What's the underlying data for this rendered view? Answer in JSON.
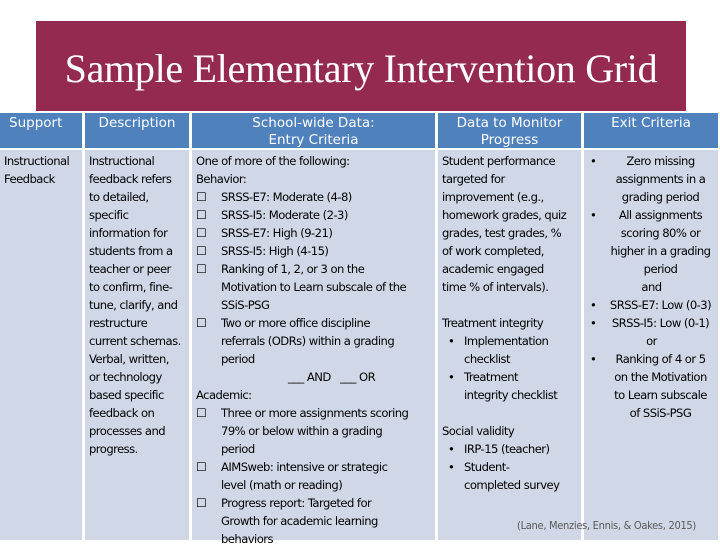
{
  "title": "Sample Elementary Intervention Grid",
  "colors": {
    "banner": "#952a51",
    "header": "#4f81bd",
    "cell": "#d0d8e8"
  },
  "headers": {
    "support": "Support",
    "description": "Description",
    "entry": [
      "School-wide Data:",
      "Entry Criteria"
    ],
    "monitor": [
      "Data to Monitor",
      "Progress"
    ],
    "exit": "Exit Criteria"
  },
  "row": {
    "support": [
      "Instructional",
      "Feedback"
    ],
    "description": [
      "Instructional",
      "feedback refers",
      "to detailed,",
      "specific",
      "information for",
      "students from a",
      "teacher or peer",
      "to confirm, fine-",
      "tune, clarify, and",
      "restructure",
      "current schemas.",
      "Verbal, written,",
      "or technology",
      "based specific",
      "feedback on",
      "processes and",
      "progress."
    ],
    "entry": {
      "intro": "One of more of the following:",
      "behavior_label": "Behavior:",
      "behavior_items": [
        [
          "SRSS-E7: Moderate (4-8)"
        ],
        [
          "SRSS-I5: Moderate (2-3)"
        ],
        [
          "SRSS-E7: High (9-21)"
        ],
        [
          "SRSS-I5: High (4-15)"
        ],
        [
          "Ranking of 1, 2, or 3 on the",
          "Motivation to Learn subscale of the",
          "SSiS-PSG"
        ],
        [
          "Two or more office discipline",
          "referrals (ODRs) within a grading",
          "period"
        ]
      ],
      "connector": "___ AND   ___ OR",
      "academic_label": "Academic:",
      "academic_items": [
        [
          "Three or more assignments scoring",
          "79% or below within a grading",
          "period"
        ],
        [
          "AIMSweb: intensive or strategic",
          "level (math or reading)"
        ],
        [
          "Progress report: Targeted for",
          "Growth for academic learning",
          "behaviors"
        ]
      ],
      "checkbox_glyph": "☐"
    },
    "monitor": {
      "performance": [
        "Student performance",
        "targeted for",
        "improvement (e.g.,",
        "homework grades, quiz",
        "grades, test grades, %",
        "of work completed,",
        "academic engaged",
        "time % of intervals)."
      ],
      "integrity_label": "Treatment integrity",
      "integrity_items": [
        [
          "Implementation",
          "checklist"
        ],
        [
          "Treatment",
          "integrity checklist"
        ]
      ],
      "validity_label": "Social validity",
      "validity_items": [
        [
          "IRP-15 (teacher)"
        ],
        [
          "Student-",
          "completed survey"
        ]
      ],
      "bullet_glyph": "•"
    },
    "exit": {
      "items_a": [
        [
          "Zero missing",
          "assignments in a",
          "grading period"
        ],
        [
          "All assignments",
          "scoring 80% or",
          "higher in a grading",
          "period"
        ]
      ],
      "and": "and",
      "items_b": [
        [
          "SRSS-E7: Low (0-3)"
        ],
        [
          "SRSS-I5: Low (0-1)"
        ]
      ],
      "or": "or",
      "items_c": [
        [
          "Ranking of 4 or 5",
          "on the Motivation",
          "to Learn subscale",
          "of SSiS-PSG"
        ]
      ],
      "bullet_glyph": "•"
    }
  },
  "citation": "(Lane, Menzies, Ennis, & Oakes, 2015)"
}
